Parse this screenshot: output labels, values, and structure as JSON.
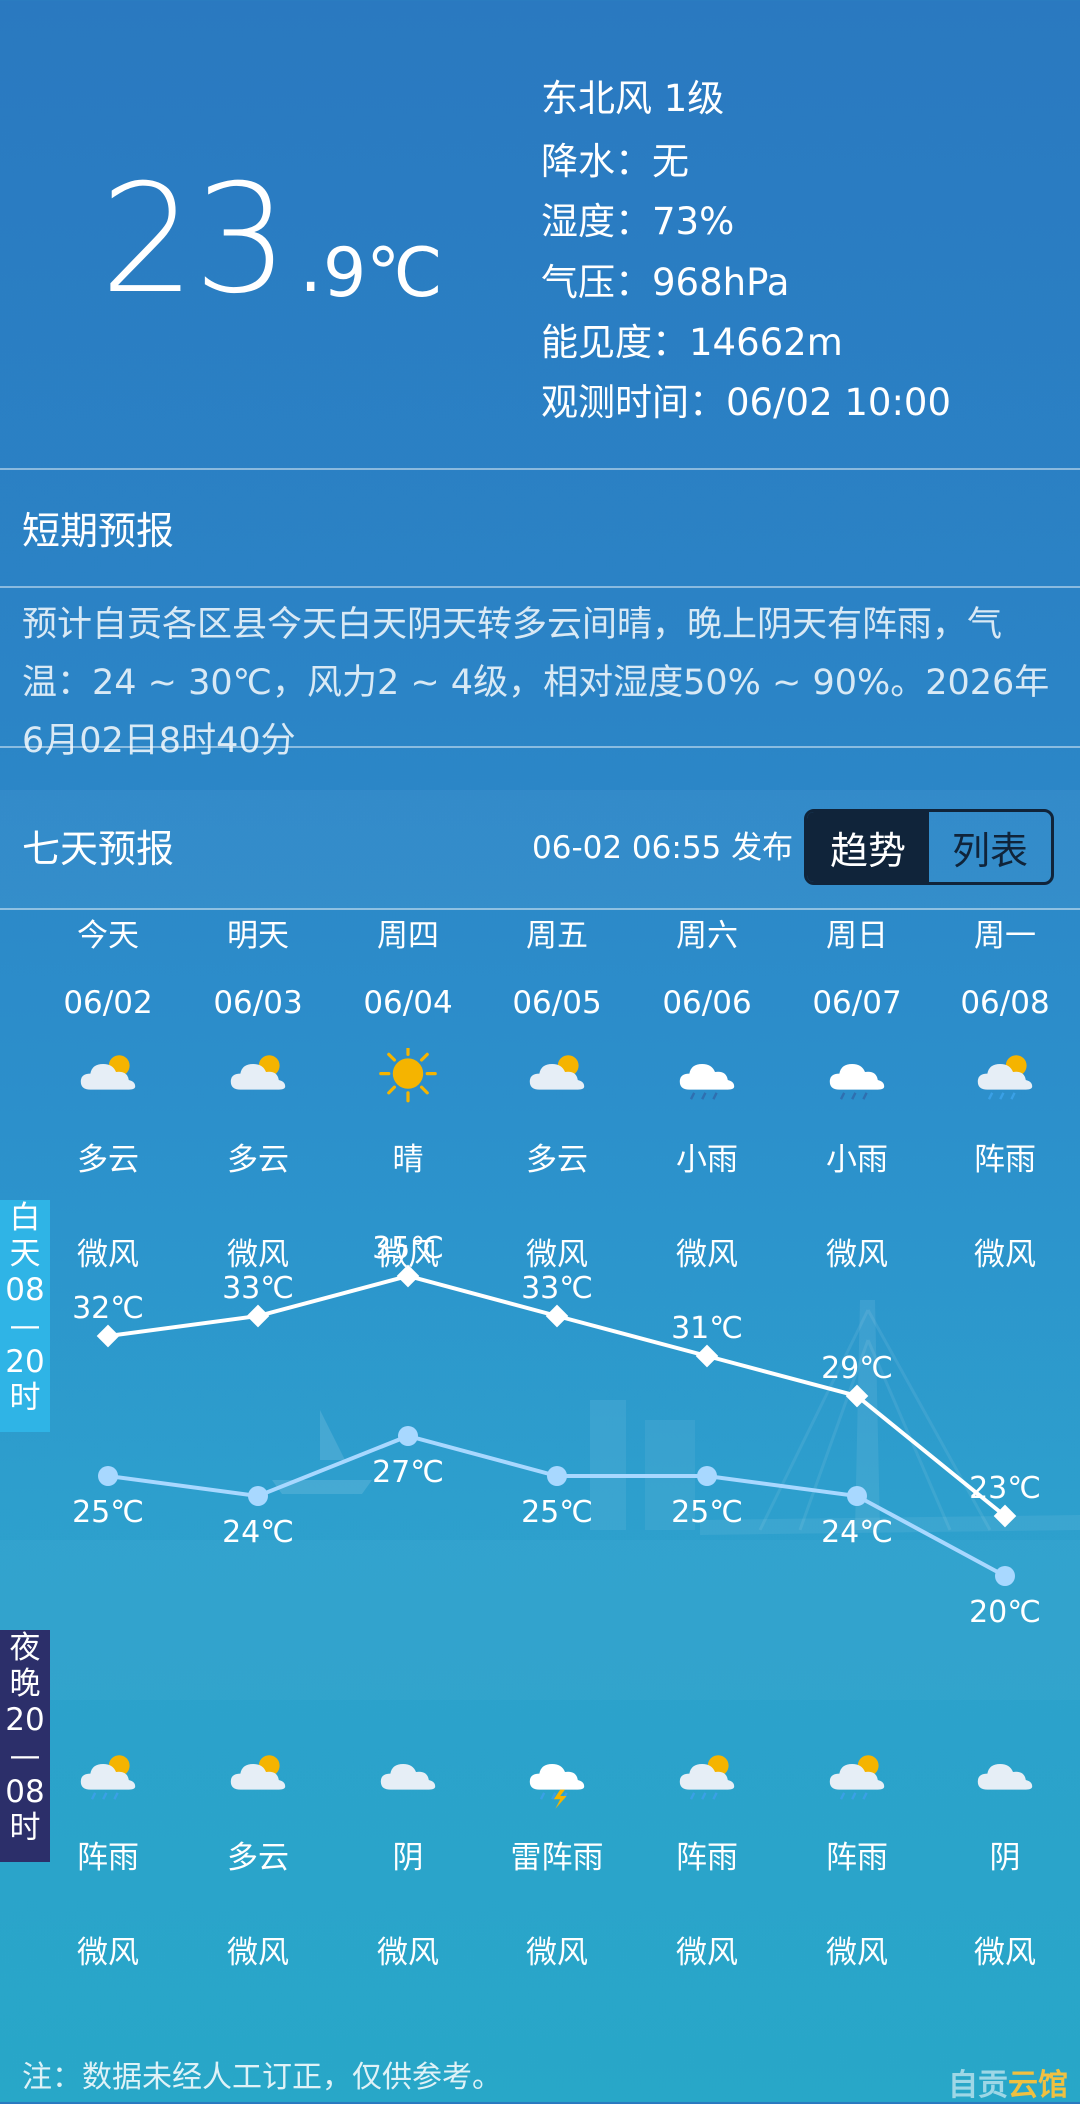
{
  "current": {
    "temp_int": "23.",
    "temp_dec": "9℃",
    "wind": "东北风 1级",
    "precip": "降水：无",
    "humidity": "湿度：73%",
    "pressure": "气压：968hPa",
    "visibility": "能见度：14662m",
    "obs_time": "观测时间：06/02 10:00"
  },
  "short_forecast": {
    "title": "短期预报",
    "text": "预计自贡各区县今天白天阴天转多云间晴，晚上阴天有阵雨，气温：24 ~ 30℃，风力2 ~ 4级，相对湿度50% ~ 90%。2026年6月02日8时40分"
  },
  "seven_day": {
    "title": "七天预报",
    "published": "06-02 06:55 发布",
    "toggle": {
      "trend": "趋势",
      "list": "列表"
    },
    "day_tag": "白天08—20时",
    "night_tag": "夜晚20—08时",
    "days": [
      {
        "name": "今天",
        "date": "06/02",
        "day_icon": "partly-cloudy-icon",
        "day_weather": "多云",
        "day_wind": "微风",
        "high": 32,
        "high_label": "32℃",
        "low": 25,
        "low_label": "25℃",
        "night_icon": "shower-icon",
        "night_weather": "阵雨",
        "night_wind": "微风"
      },
      {
        "name": "明天",
        "date": "06/03",
        "day_icon": "partly-cloudy-icon",
        "day_weather": "多云",
        "day_wind": "微风",
        "high": 33,
        "high_label": "33℃",
        "low": 24,
        "low_label": "24℃",
        "night_icon": "partly-cloudy-icon",
        "night_weather": "多云",
        "night_wind": "微风"
      },
      {
        "name": "周四",
        "date": "06/04",
        "day_icon": "sunny-icon",
        "day_weather": "晴",
        "day_wind": "微风",
        "high": 35,
        "high_label": "35℃",
        "low": 27,
        "low_label": "27℃",
        "night_icon": "overcast-icon",
        "night_weather": "阴",
        "night_wind": "微风"
      },
      {
        "name": "周五",
        "date": "06/05",
        "day_icon": "partly-cloudy-icon",
        "day_weather": "多云",
        "day_wind": "微风",
        "high": 33,
        "high_label": "33℃",
        "low": 25,
        "low_label": "25℃",
        "night_icon": "thunder-shower-icon",
        "night_weather": "雷阵雨",
        "night_wind": "微风"
      },
      {
        "name": "周六",
        "date": "06/06",
        "day_icon": "light-rain-icon",
        "day_weather": "小雨",
        "day_wind": "微风",
        "high": 31,
        "high_label": "31℃",
        "low": 25,
        "low_label": "25℃",
        "night_icon": "shower-icon",
        "night_weather": "阵雨",
        "night_wind": "微风"
      },
      {
        "name": "周日",
        "date": "06/07",
        "day_icon": "light-rain-icon",
        "day_weather": "小雨",
        "day_wind": "微风",
        "high": 29,
        "high_label": "29℃",
        "low": 24,
        "low_label": "24℃",
        "night_icon": "shower-icon",
        "night_weather": "阵雨",
        "night_wind": "微风"
      },
      {
        "name": "周一",
        "date": "06/08",
        "day_icon": "shower-icon",
        "day_weather": "阵雨",
        "day_wind": "微风",
        "high": 23,
        "high_label": "23℃",
        "low": 20,
        "low_label": "20℃",
        "night_icon": "overcast-icon",
        "night_weather": "阴",
        "night_wind": "微风"
      }
    ]
  },
  "note": "注：数据未经人工订正，仅供参考。",
  "watermark": "自贡云馆",
  "colors": {
    "high_line": "#ffffff",
    "low_line": "#a8d8ff",
    "toggle_dark": "#10243a",
    "sun": "#f5b400"
  }
}
